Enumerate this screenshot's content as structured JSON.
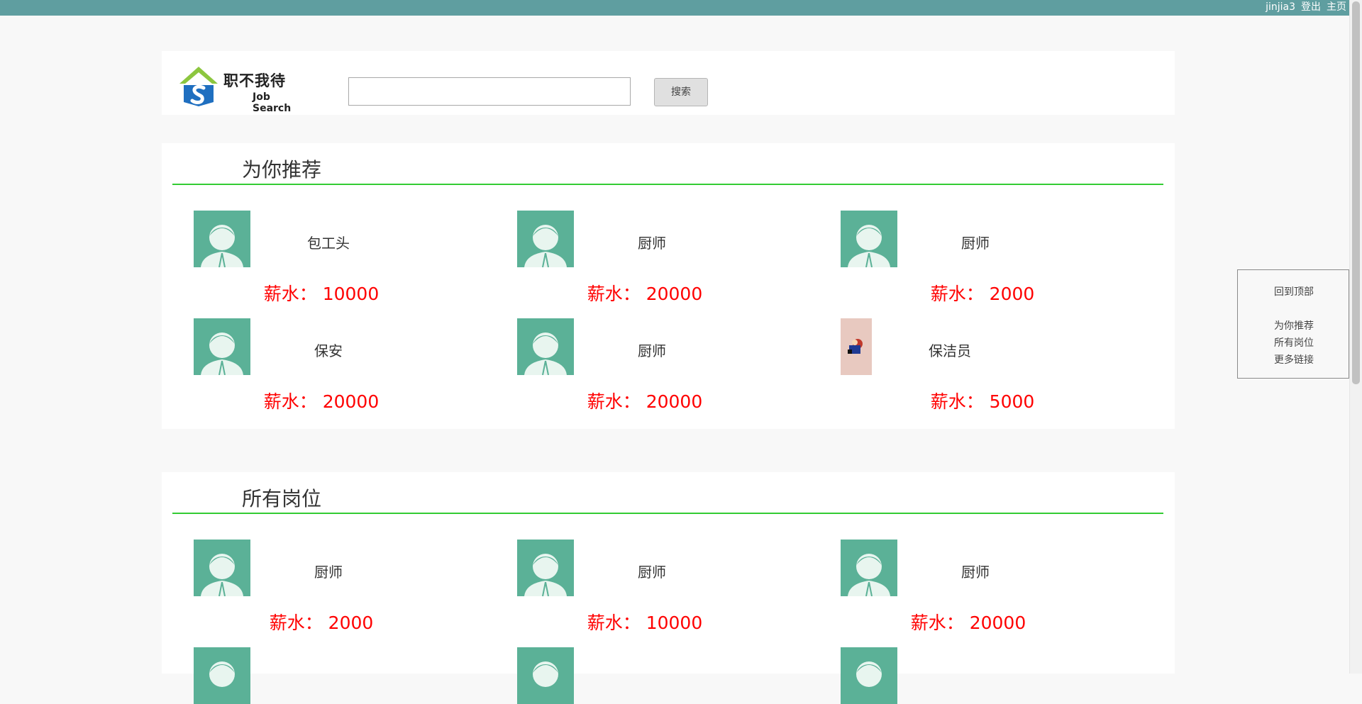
{
  "topbar": {
    "user": "jinjia3",
    "logout": "登出",
    "home": "主页"
  },
  "header": {
    "logo_cn": "职不我待",
    "logo_en": "Job Search",
    "search_value": "",
    "search_button": "搜索"
  },
  "recommend": {
    "title": "为你推荐",
    "jobs": [
      {
        "name": "包工头",
        "salary_label": "薪水：",
        "salary": "10000"
      },
      {
        "name": "厨师",
        "salary_label": "薪水：",
        "salary": "20000"
      },
      {
        "name": "厨师",
        "salary_label": "薪水：",
        "salary": "2000"
      },
      {
        "name": "保安",
        "salary_label": "薪水：",
        "salary": "20000"
      },
      {
        "name": "厨师",
        "salary_label": "薪水：",
        "salary": "20000"
      },
      {
        "name": "保洁员",
        "salary_label": "薪水：",
        "salary": "5000"
      }
    ]
  },
  "all_jobs": {
    "title": "所有岗位",
    "jobs": [
      {
        "name": "厨师",
        "salary_label": "薪水：",
        "salary": "2000"
      },
      {
        "name": "厨师",
        "salary_label": "薪水：",
        "salary": "10000"
      },
      {
        "name": "厨师",
        "salary_label": "薪水：",
        "salary": "20000"
      }
    ]
  },
  "side_nav": {
    "back_to_top": "回到顶部",
    "recommend": "为你推荐",
    "all_jobs": "所有岗位",
    "more_links": "更多链接"
  },
  "colors": {
    "topbar": "#5f9ea0",
    "accent_rule": "#33cc33",
    "salary": "#ff0000",
    "avatar": "#5bb197"
  }
}
